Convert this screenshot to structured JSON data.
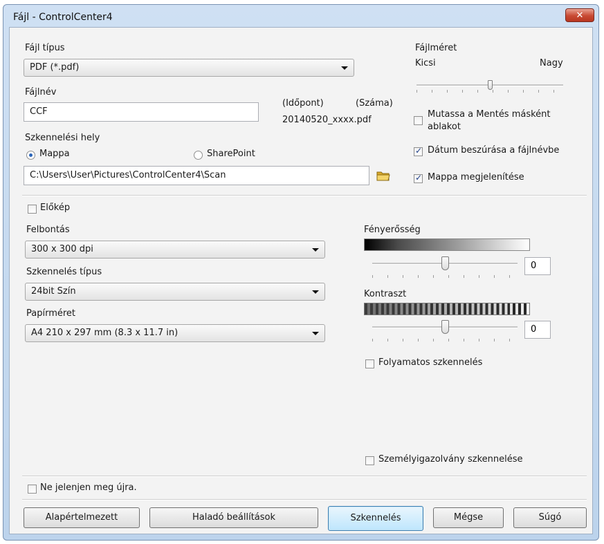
{
  "window": {
    "title": "Fájl - ControlCenter4",
    "close_label": "✕"
  },
  "file_type": {
    "label": "Fájl típus",
    "value": "PDF (*.pdf)"
  },
  "file_name": {
    "label": "Fájlnév",
    "value": "CCF",
    "time_label": "(Időpont)",
    "number_label": "(Száma)",
    "sample": "20140520_xxxx.pdf"
  },
  "file_size": {
    "label": "Fájlméret",
    "min_label": "Kicsi",
    "max_label": "Nagy",
    "level": 0.5
  },
  "options_right": {
    "show_save_as": {
      "label_line1": "Mutassa a Mentés másként",
      "label_line2": "ablakot",
      "checked": false
    },
    "insert_date": {
      "label": "Dátum beszúrása a fájlnévbe",
      "checked": true
    },
    "show_folder": {
      "label": "Mappa megjelenítése",
      "checked": true
    }
  },
  "scan_location": {
    "label": "Szkennelési hely",
    "folder_option": "Mappa",
    "sharepoint_option": "SharePoint",
    "selected": "Mappa",
    "path": "C:\\Users\\User\\Pictures\\ControlCenter4\\Scan"
  },
  "preview": {
    "label": "Előkép",
    "checked": false
  },
  "resolution": {
    "label": "Felbontás",
    "value": "300 x 300 dpi"
  },
  "scan_type": {
    "label": "Szkennelés típus",
    "value": "24bit Szín"
  },
  "paper_size": {
    "label": "Papírméret",
    "value": "A4 210 x 297 mm (8.3 x 11.7 in)"
  },
  "brightness": {
    "label": "Fényerősség",
    "value": "0",
    "level": 0.5
  },
  "contrast": {
    "label": "Kontraszt",
    "value": "0",
    "level": 0.5
  },
  "continuous_scan": {
    "label": "Folyamatos szkennelés",
    "checked": false
  },
  "id_card_scan": {
    "label": "Személyigazolvány szkennelése",
    "checked": false
  },
  "dont_show_again": {
    "label": "Ne jelenjen meg újra.",
    "checked": false
  },
  "buttons": {
    "default": "Alapértelmezett",
    "advanced": "Haladó beállítások",
    "scan": "Szkennelés",
    "cancel": "Mégse",
    "help": "Súgó"
  },
  "colors": {
    "accent": "#2a64b8",
    "close_button": "#c84a33",
    "folder_icon": "#e8c34a"
  }
}
